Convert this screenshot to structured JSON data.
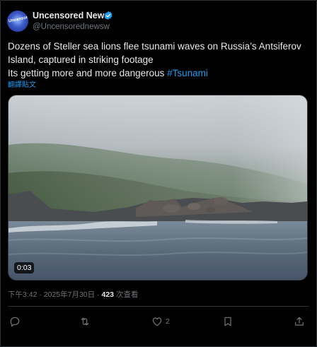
{
  "post": {
    "author_name": "Uncensored News",
    "handle": "@Uncensorednewsw",
    "avatar_text": "Uncensored",
    "text_line1": "Dozens of Steller sea lions flee tsunami waves on Russia’s Antsiferov Island, captured in striking footage",
    "text_line2": "Its getting more and more dangerous ",
    "hashtag": "#Tsunami",
    "translate_label": "翻譯貼文",
    "video_duration": "0:03",
    "timestamp": "下午3:42 · 2025年7月30日 · ",
    "views": "423",
    "views_label": " 次查看"
  },
  "actions": {
    "reply_count": "",
    "repost_count": "",
    "like_count": "2",
    "bookmark_count": ""
  },
  "colors": {
    "accent": "#1d9bf0",
    "muted": "#71767b",
    "text": "#e7e9ea",
    "background": "#000000"
  },
  "icons": [
    "verified-badge-icon",
    "reply-icon",
    "repost-icon",
    "like-icon",
    "bookmark-icon",
    "share-icon"
  ]
}
